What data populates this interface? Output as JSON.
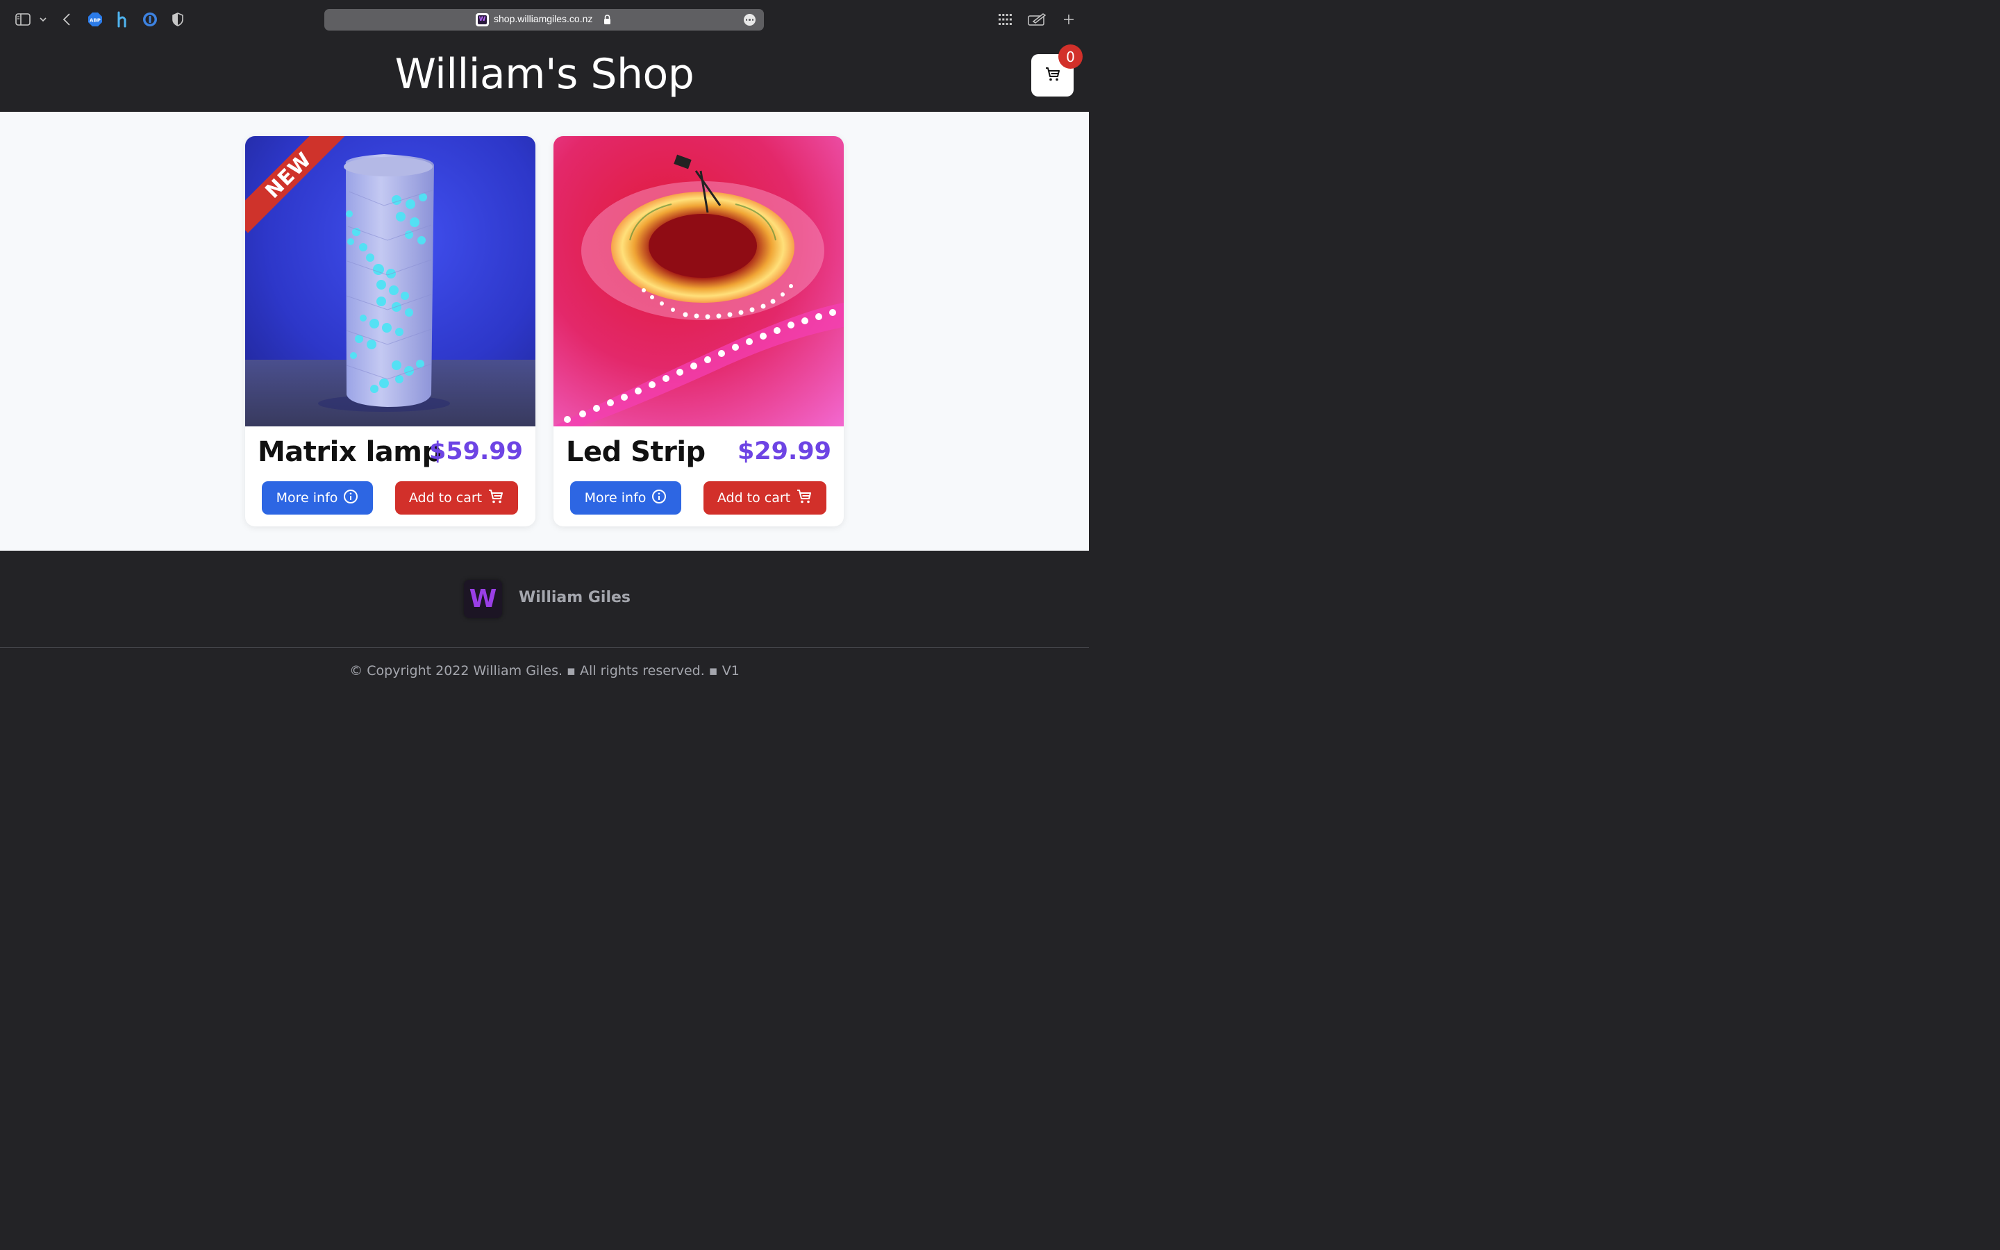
{
  "browser": {
    "url": "shop.williamgiles.co.nz",
    "favicon_letter": "W",
    "extension_abp_label": "ABP"
  },
  "header": {
    "title": "William's Shop",
    "cart_count": "0"
  },
  "products": [
    {
      "name": "Matrix lamp",
      "price": "$59.99",
      "badge": "NEW",
      "more_info_label": "More info",
      "add_to_cart_label": "Add to cart"
    },
    {
      "name": "Led Strip",
      "price": "$29.99",
      "more_info_label": "More info",
      "add_to_cart_label": "Add to cart"
    }
  ],
  "footer": {
    "logo_letter": "W",
    "name": "William Giles",
    "copyright": "© Copyright 2022 William Giles. ▪ All rights reserved. ▪ V1"
  },
  "colors": {
    "dark_bg": "#232326",
    "accent_price": "#6d44e4",
    "info_button": "#2d66e3",
    "cart_button": "#d2302a"
  }
}
